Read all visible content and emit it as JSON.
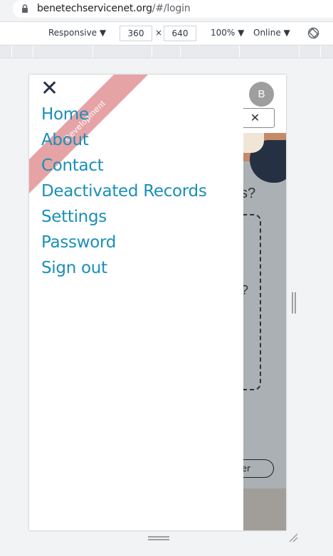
{
  "browser": {
    "url_host": "benetechservicenet.org",
    "url_path": "/#/login"
  },
  "device_toolbar": {
    "device": "Responsive",
    "width": "360",
    "height": "640",
    "zoom": "100%",
    "network": "Online"
  },
  "app": {
    "avatar_initial": "B",
    "close_button": "✕",
    "question_partial_1": "s?",
    "question_partial_2": "?",
    "pill_partial": "er"
  },
  "drawer": {
    "close_icon": "✕",
    "ribbon_label": "Development",
    "nav_items": [
      {
        "label": "Home"
      },
      {
        "label": "About"
      },
      {
        "label": "Contact"
      },
      {
        "label": "Deactivated Records"
      },
      {
        "label": "Settings"
      },
      {
        "label": "Password"
      },
      {
        "label": "Sign out"
      }
    ]
  },
  "colors": {
    "nav_link": "#1a8fb8",
    "ribbon": "#e6a3a6",
    "close_icon": "#26304a"
  }
}
